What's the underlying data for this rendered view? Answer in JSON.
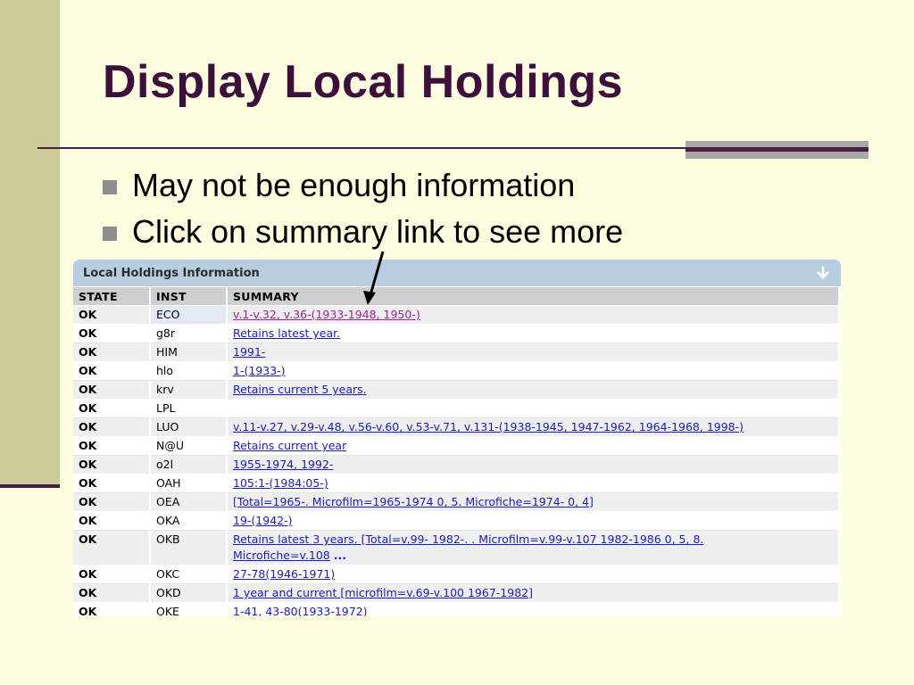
{
  "slide": {
    "title": "Display Local Holdings",
    "bullets": [
      "May not be enough information",
      "Click on summary link to see more"
    ]
  },
  "panel": {
    "title": "Local Holdings Information",
    "icon": "down-arrow-icon",
    "columns": [
      "STATE",
      "INST",
      "SUMMARY"
    ],
    "rows": [
      {
        "state": "OK",
        "inst": "ECO",
        "summary": "v.1-v.32, v.36-(1933-1948, 1950-)"
      },
      {
        "state": "OK",
        "inst": "g8r",
        "summary": "Retains latest year."
      },
      {
        "state": "OK",
        "inst": "HIM",
        "summary": "1991-"
      },
      {
        "state": "OK",
        "inst": "hlo",
        "summary": "1-(1933-)"
      },
      {
        "state": "OK",
        "inst": "krv",
        "summary": "Retains current 5 years."
      },
      {
        "state": "OK",
        "inst": "LPL",
        "summary": ""
      },
      {
        "state": "OK",
        "inst": "LUO",
        "summary": "v.11-v.27, v.29-v.48, v.56-v.60, v.53-v.71, v.131-(1938-1945, 1947-1962, 1964-1968, 1998-)"
      },
      {
        "state": "OK",
        "inst": "N@U",
        "summary": "Retains current year"
      },
      {
        "state": "OK",
        "inst": "o2l",
        "summary": "1955-1974, 1992-"
      },
      {
        "state": "OK",
        "inst": "OAH",
        "summary": "105:1-(1984:05-)"
      },
      {
        "state": "OK",
        "inst": "OEA",
        "summary": "[Total=1965-. Microfilm=1965-1974 0, 5. Microfiche=1974- 0, 4]"
      },
      {
        "state": "OK",
        "inst": "OKA",
        "summary": "19-(1942-)"
      },
      {
        "state": "OK",
        "inst": "OKB",
        "summary": "Retains latest 3 years. [Total=v.99- 1982-. . Microfilm=v.99-v.107 1982-1986 0, 5, 8.",
        "summary_line2": "Microfiche=v.108",
        "more": "..."
      },
      {
        "state": "OK",
        "inst": "OKC",
        "summary": "27-78(1946-1971)"
      },
      {
        "state": "OK",
        "inst": "OKD",
        "summary": "1 year and current [microfilm=v.69-v.100 1967-1982]"
      },
      {
        "state": "OK",
        "inst": "OKE",
        "summary": "1-41, 43-80(1933-1972)"
      }
    ]
  },
  "colors": {
    "background": "#FFFDE0",
    "title": "#3D0F3C",
    "panel_header": "#B7CEE1",
    "link": "#1A1ACC",
    "visited_link": "#A020A0"
  }
}
